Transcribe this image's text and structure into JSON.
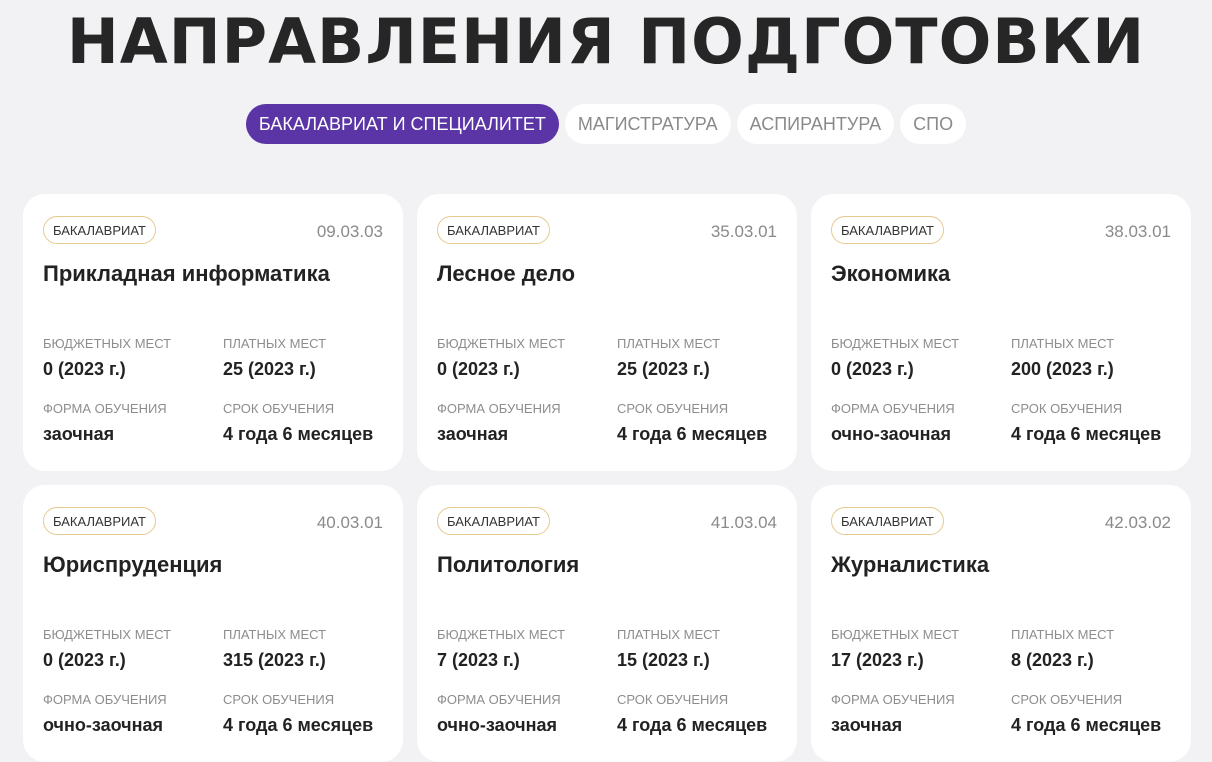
{
  "title": "НАПРАВЛЕНИЯ ПОДГОТОВКИ",
  "tabs": [
    {
      "label": "БАКАЛАВРИАТ И СПЕЦИАЛИТЕТ",
      "active": true
    },
    {
      "label": "МАГИСТРАТУРА",
      "active": false
    },
    {
      "label": "АСПИРАНТУРА",
      "active": false
    },
    {
      "label": "СПО",
      "active": false
    }
  ],
  "labels": {
    "budget": "БЮДЖЕТНЫХ МЕСТ",
    "paid": "ПЛАТНЫХ МЕСТ",
    "form": "ФОРМА ОБУЧЕНИЯ",
    "duration": "СРОК ОБУЧЕНИЯ"
  },
  "cards": [
    {
      "badge": "БАКАЛАВРИАТ",
      "code": "09.03.03",
      "name": "Прикладная информатика",
      "budget": "0 (2023 г.)",
      "paid": "25 (2023 г.)",
      "form": "заочная",
      "duration": "4 года 6 месяцев"
    },
    {
      "badge": "БАКАЛАВРИАТ",
      "code": "35.03.01",
      "name": "Лесное дело",
      "budget": "0 (2023 г.)",
      "paid": "25 (2023 г.)",
      "form": "заочная",
      "duration": "4 года 6 месяцев"
    },
    {
      "badge": "БАКАЛАВРИАТ",
      "code": "38.03.01",
      "name": "Экономика",
      "budget": "0 (2023 г.)",
      "paid": "200 (2023 г.)",
      "form": "очно-заочная",
      "duration": "4 года 6 месяцев"
    },
    {
      "badge": "БАКАЛАВРИАТ",
      "code": "40.03.01",
      "name": "Юриспруденция",
      "budget": "0 (2023 г.)",
      "paid": "315 (2023 г.)",
      "form": "очно-заочная",
      "duration": "4 года 6 месяцев"
    },
    {
      "badge": "БАКАЛАВРИАТ",
      "code": "41.03.04",
      "name": "Политология",
      "budget": "7 (2023 г.)",
      "paid": "15 (2023 г.)",
      "form": "очно-заочная",
      "duration": "4 года 6 месяцев"
    },
    {
      "badge": "БАКАЛАВРИАТ",
      "code": "42.03.02",
      "name": "Журналистика",
      "budget": "17 (2023 г.)",
      "paid": "8 (2023 г.)",
      "form": "заочная",
      "duration": "4 года 6 месяцев"
    }
  ]
}
